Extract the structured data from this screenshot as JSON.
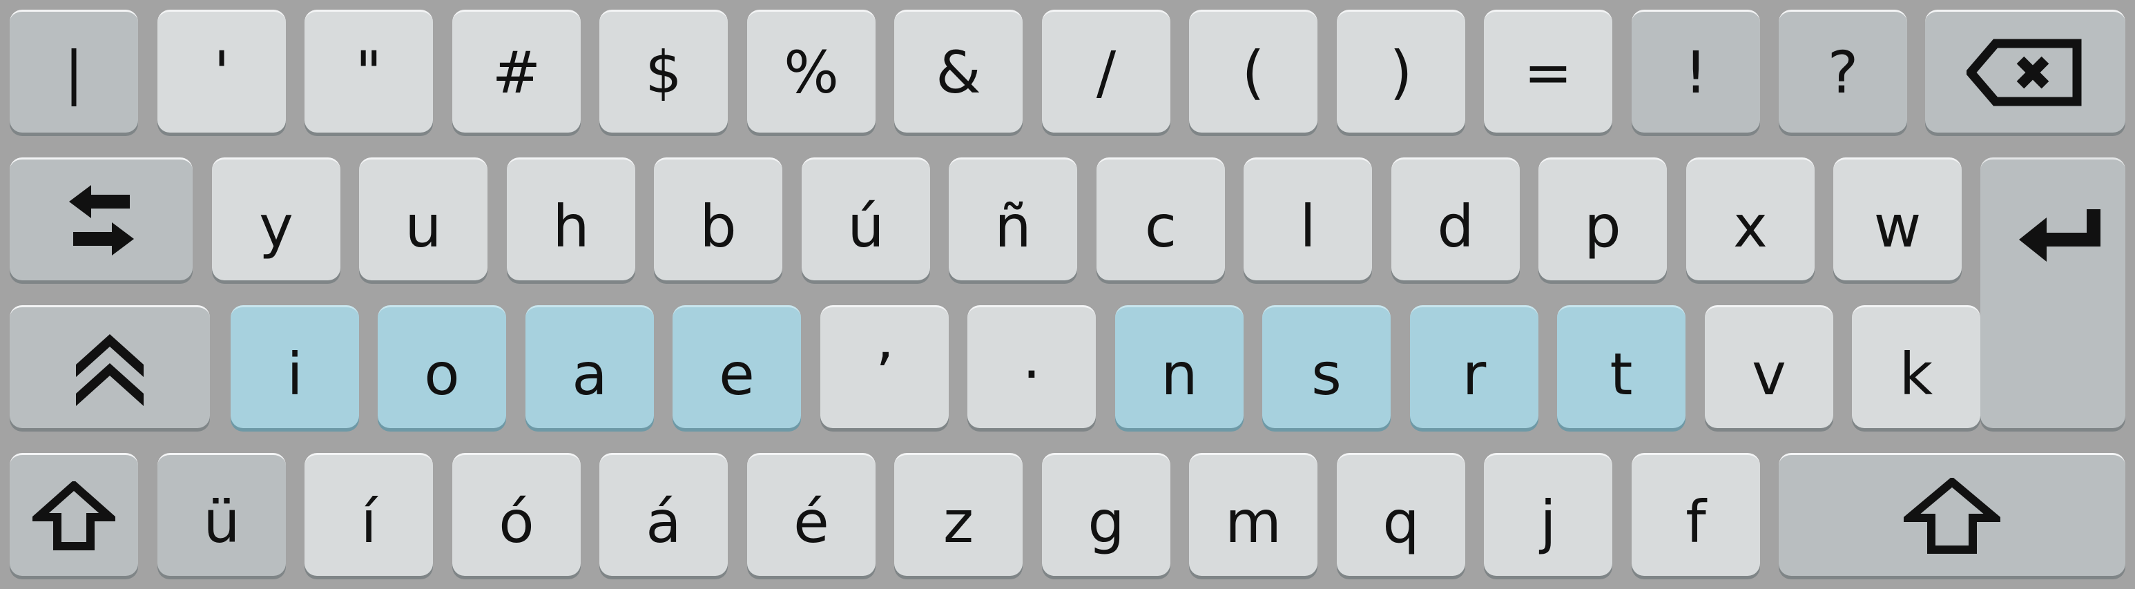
{
  "keyboard": {
    "row1": [
      "|",
      "'",
      "\"",
      "#",
      "$",
      "%",
      "&",
      "/",
      "(",
      ")",
      "=",
      "!",
      "?"
    ],
    "row2": [
      "y",
      "u",
      "h",
      "b",
      "ú",
      "ñ",
      "c",
      "l",
      "d",
      "p",
      "x",
      "w"
    ],
    "row3": [
      "i",
      "o",
      "a",
      "e",
      "’",
      "·",
      "n",
      "s",
      "r",
      "t",
      "v",
      "k"
    ],
    "row4": [
      "ü",
      "í",
      "ó",
      "á",
      "é",
      "z",
      "g",
      "m",
      "q",
      "j",
      "f"
    ],
    "icons": {
      "backspace": "backspace-icon",
      "swap": "swap-layout-icon",
      "enter": "enter-icon",
      "caps": "caps-lock-icon",
      "shift": "shift-icon"
    },
    "colors": {
      "background": "#a3a3a3",
      "key": "#d8dbdc",
      "special_key": "#b9bec0",
      "highlight_key": "#a7d1de"
    }
  }
}
